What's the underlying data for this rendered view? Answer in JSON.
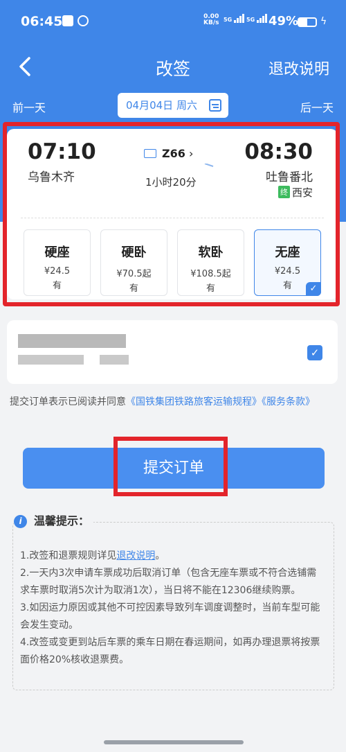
{
  "status_bar": {
    "time": "06:45",
    "net_speed_value": "0.00",
    "net_speed_unit": "KB/s",
    "sig1": "5G",
    "sig2": "5G",
    "battery": "49%"
  },
  "header": {
    "title": "改签",
    "help_label": "退改说明"
  },
  "date_nav": {
    "prev": "前一天",
    "date": "04月04日 周六",
    "next": "后一天"
  },
  "train": {
    "dep_time": "07:10",
    "dep_station": "乌鲁木齐",
    "arr_time": "08:30",
    "arr_station": "吐鲁番北",
    "number": "Z66",
    "duration": "1小时20分",
    "terminal_badge": "终",
    "terminal_station": "西安",
    "seats": [
      {
        "name": "硬座",
        "price": "¥24.5",
        "avail": "有"
      },
      {
        "name": "硬卧",
        "price": "¥70.5起",
        "avail": "有"
      },
      {
        "name": "软卧",
        "price": "¥108.5起",
        "avail": "有"
      },
      {
        "name": "无座",
        "price": "¥24.5",
        "avail": "有"
      }
    ]
  },
  "agreement": {
    "prefix": "提交订单表示已阅读并同意",
    "link": "《国铁集团铁路旅客运输规程》《服务条款》"
  },
  "submit_label": "提交订单",
  "tips": {
    "title": "温馨提示：",
    "line1_pre": "1.改签和退票规则详见",
    "line1_link": "退改说明",
    "line1_post": "。",
    "line2": "2.一天内3次申请车票成功后取消订单（包含无座车票或不符合选铺需求车票时取消5次计为取消1次），当日将不能在12306继续购票。",
    "line3": "3.如因运力原因或其他不可控因素导致列车调度调整时，当前车型可能会发生变动。",
    "line4": "4.改签或变更到站后车票的乘车日期在春运期间，如再办理退票将按票面价格20%核收退票费。"
  },
  "colors": {
    "primary": "#3f86e8",
    "highlight_red": "#e3242b"
  }
}
